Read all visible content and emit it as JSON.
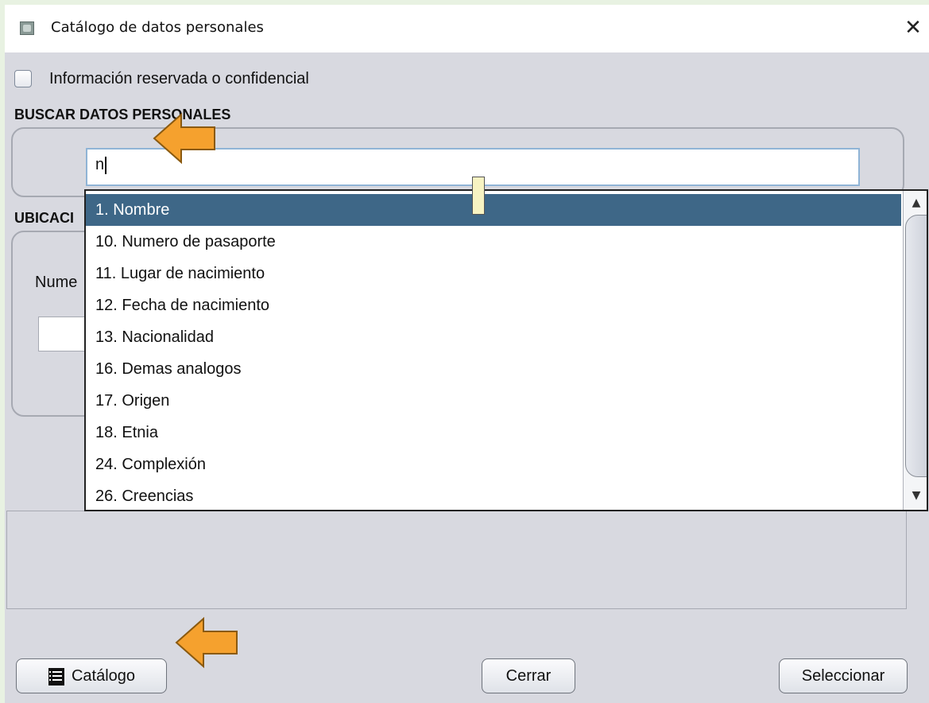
{
  "window": {
    "title": "Catálogo de datos personales",
    "close_glyph": "✕"
  },
  "checkbox": {
    "label": "Información reservada o confidencial",
    "checked": false
  },
  "search_section": {
    "title": "BUSCAR DATOS PERSONALES",
    "input_value": "n"
  },
  "location_section": {
    "title": "UBICACI",
    "field_label": "Nume"
  },
  "dropdown": {
    "items": [
      "1. Nombre",
      "10. Numero de pasaporte",
      "11. Lugar de nacimiento",
      "12. Fecha de nacimiento",
      "13. Nacionalidad",
      "16. Demas analogos",
      "17. Origen",
      "18. Etnia",
      "24. Complexión",
      "26. Creencias"
    ],
    "selected_index": 0,
    "scroll_up_glyph": "▲",
    "scroll_down_glyph": "▼"
  },
  "buttons": {
    "catalogo": "Catálogo",
    "cerrar": "Cerrar",
    "seleccionar": "Seleccionar"
  },
  "colors": {
    "highlight": "#3e6787",
    "annotation_arrow": "#f5a12e",
    "background": "#d8d9e0"
  },
  "icons": {
    "window_icon": "app-icon",
    "catalogo_icon": "book-icon",
    "annotation": "arrow-left-icon"
  }
}
